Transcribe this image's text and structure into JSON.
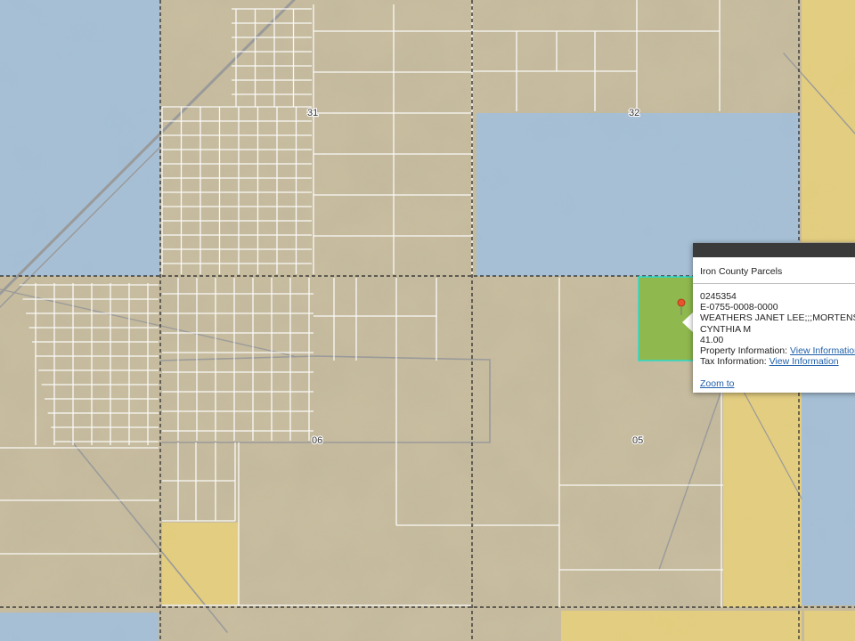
{
  "map": {
    "section_labels": [
      {
        "id": "sec-31",
        "text": "31"
      },
      {
        "id": "sec-32",
        "text": "32"
      },
      {
        "id": "sec-06",
        "text": "06"
      },
      {
        "id": "sec-05",
        "text": "05"
      }
    ],
    "colors": {
      "terrain": "#c9bea0",
      "public_land_blue": "#9fbfe0",
      "state_land_yellow": "#e8d07a",
      "selected_parcel_green": "#8fb84e",
      "selected_parcel_outline": "#31d9c9",
      "parcel_line": "#ffffff",
      "section_line": "#222222",
      "road": "#9a9a9a",
      "marker": "#e8532b"
    }
  },
  "popup": {
    "title": "Iron County Parcels",
    "parcel_number": "0245354",
    "account_number": "E-0755-0008-0000",
    "owner_line1": "WEATHERS JANET LEE;;;MORTENSEN",
    "owner_line2": "CYNTHIA M",
    "acres": "41.00",
    "property_info_label": "Property Information:",
    "property_info_link": "View Information",
    "tax_info_label": "Tax Information:",
    "tax_info_link": "View Information",
    "zoom_link": "Zoom to"
  }
}
